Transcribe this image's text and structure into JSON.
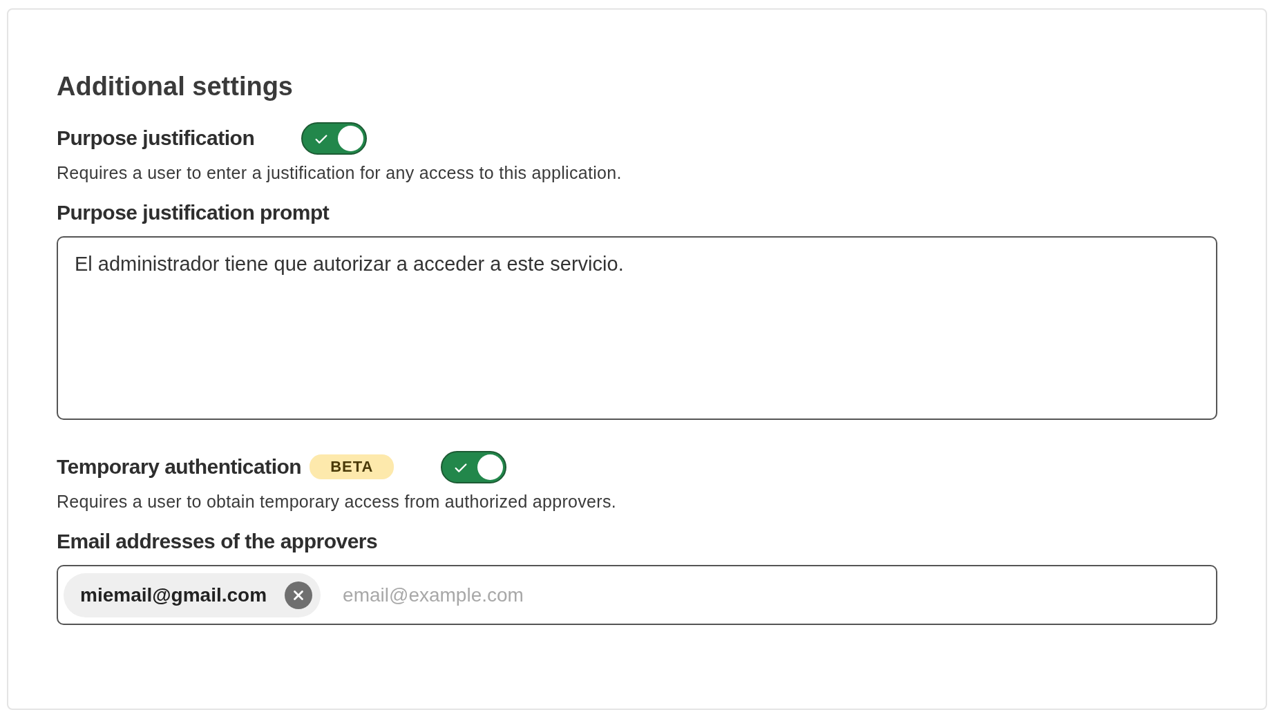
{
  "title": "Additional settings",
  "sections": [
    {
      "label": "Purpose justification",
      "on": true,
      "description": "Requires a user to enter a justification for any access to this application.",
      "field_label": "Purpose justification prompt",
      "kind": "textarea",
      "value": "El administrador tiene que autorizar a acceder a este servicio."
    },
    {
      "label": "Temporary authentication",
      "badge": "BETA",
      "on": true,
      "description": "Requires a user to obtain temporary access from authorized approvers.",
      "field_label": "Email addresses of the approvers",
      "kind": "chips",
      "chips": [
        "miemail@gmail.com"
      ],
      "placeholder": "email@example.com"
    }
  ]
}
